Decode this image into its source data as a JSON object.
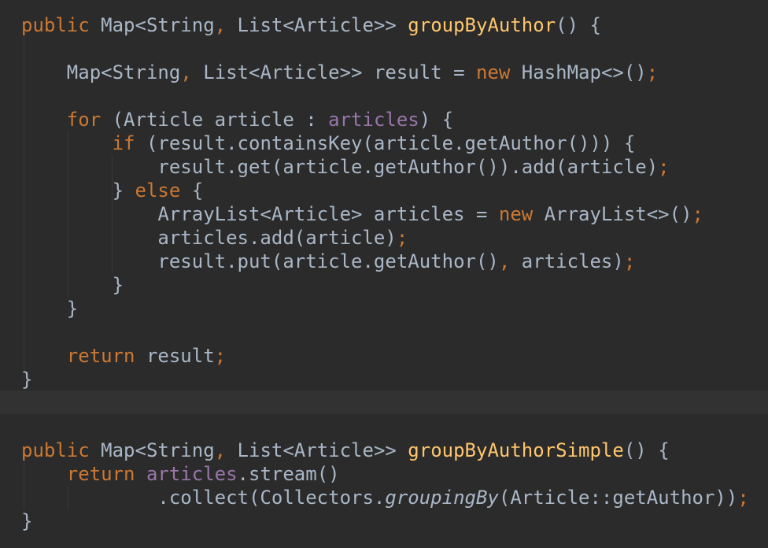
{
  "editor": {
    "theme_colors": {
      "background": "#2b2b2b",
      "current_line": "#323232",
      "default_text": "#a9b7c6",
      "keyword": "#cc7832",
      "method_declaration": "#ffc66d",
      "field": "#9876aa"
    },
    "lines": [
      [
        {
          "t": "public",
          "c": "kw"
        },
        {
          "t": " Map<String",
          "c": ""
        },
        {
          "t": ",",
          "c": "punct"
        },
        {
          "t": " List<Article>> ",
          "c": ""
        },
        {
          "t": "groupByAuthor",
          "c": "fn"
        },
        {
          "t": "() {",
          "c": ""
        }
      ],
      [],
      [
        {
          "t": "    Map<String",
          "c": ""
        },
        {
          "t": ",",
          "c": "punct"
        },
        {
          "t": " List<Article>> result = ",
          "c": ""
        },
        {
          "t": "new",
          "c": "kw"
        },
        {
          "t": " HashMap<>()",
          "c": ""
        },
        {
          "t": ";",
          "c": "punct"
        }
      ],
      [],
      [
        {
          "t": "    ",
          "c": ""
        },
        {
          "t": "for",
          "c": "kw"
        },
        {
          "t": " (Article article : ",
          "c": ""
        },
        {
          "t": "articles",
          "c": "field"
        },
        {
          "t": ") {",
          "c": ""
        }
      ],
      [
        {
          "t": "        ",
          "c": ""
        },
        {
          "t": "if",
          "c": "kw"
        },
        {
          "t": " (result.containsKey(article.getAuthor())) {",
          "c": ""
        }
      ],
      [
        {
          "t": "            result.get(article.getAuthor()).add(article)",
          "c": ""
        },
        {
          "t": ";",
          "c": "punct"
        }
      ],
      [
        {
          "t": "        } ",
          "c": ""
        },
        {
          "t": "else",
          "c": "kw"
        },
        {
          "t": " {",
          "c": ""
        }
      ],
      [
        {
          "t": "            ArrayList<Article> articles = ",
          "c": ""
        },
        {
          "t": "new",
          "c": "kw"
        },
        {
          "t": " ArrayList<>()",
          "c": ""
        },
        {
          "t": ";",
          "c": "punct"
        }
      ],
      [
        {
          "t": "            articles.add(article)",
          "c": ""
        },
        {
          "t": ";",
          "c": "punct"
        }
      ],
      [
        {
          "t": "            result.put(article.getAuthor()",
          "c": ""
        },
        {
          "t": ",",
          "c": "punct"
        },
        {
          "t": " articles)",
          "c": ""
        },
        {
          "t": ";",
          "c": "punct"
        }
      ],
      [
        {
          "t": "        }",
          "c": ""
        }
      ],
      [
        {
          "t": "    }",
          "c": ""
        }
      ],
      [],
      [
        {
          "t": "    ",
          "c": ""
        },
        {
          "t": "return",
          "c": "kw"
        },
        {
          "t": " result",
          "c": ""
        },
        {
          "t": ";",
          "c": "punct"
        }
      ],
      [
        {
          "t": "}",
          "c": ""
        }
      ],
      [],
      [],
      [
        {
          "t": "public",
          "c": "kw"
        },
        {
          "t": " Map<String",
          "c": ""
        },
        {
          "t": ",",
          "c": "punct"
        },
        {
          "t": " List<Article>> ",
          "c": ""
        },
        {
          "t": "groupByAuthorSimple",
          "c": "fn"
        },
        {
          "t": "() {",
          "c": ""
        }
      ],
      [
        {
          "t": "    ",
          "c": ""
        },
        {
          "t": "return",
          "c": "kw"
        },
        {
          "t": " ",
          "c": ""
        },
        {
          "t": "articles",
          "c": "field"
        },
        {
          "t": ".stream()",
          "c": ""
        }
      ],
      [
        {
          "t": "            .collect(Collectors.",
          "c": ""
        },
        {
          "t": "groupingBy",
          "c": "ital"
        },
        {
          "t": "(Article::getAuthor))",
          "c": ""
        },
        {
          "t": ";",
          "c": "punct"
        }
      ],
      [
        {
          "t": "}",
          "c": ""
        }
      ]
    ]
  }
}
